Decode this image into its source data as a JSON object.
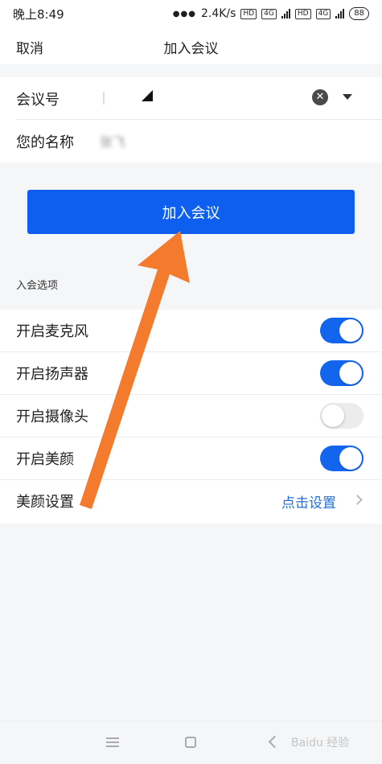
{
  "status_bar": {
    "time": "晚上8:49",
    "network_speed": "2.4K/s",
    "hd_badge_1": "HD",
    "hd_badge_2": "HD",
    "network_type_1": "4G",
    "network_type_2": "4G",
    "battery": "88"
  },
  "nav": {
    "cancel_label": "取消",
    "title": "加入会议"
  },
  "form": {
    "meeting_id_label": "会议号",
    "display_name_label": "您的名称",
    "display_name_value": "张飞",
    "clear_icon": "close-circle-icon",
    "dropdown_icon": "caret-down-icon"
  },
  "join_button_label": "加入会议",
  "options": {
    "section_title": "入会选项",
    "items": [
      {
        "label": "开启麦克风",
        "enabled": true
      },
      {
        "label": "开启扬声器",
        "enabled": true
      },
      {
        "label": "开启摄像头",
        "enabled": false
      },
      {
        "label": "开启美颜",
        "enabled": true
      }
    ],
    "beauty_settings": {
      "label": "美颜设置",
      "action": "点击设置"
    }
  },
  "system_nav": {
    "watermark": "Baidu 经验"
  },
  "colors": {
    "primary": "#0e5ff0",
    "toggle_on": "#1365ee",
    "toggle_off": "#ececec",
    "link": "#1f6fd6",
    "arrow": "#f47a2e",
    "background": "#f5f6f8"
  }
}
